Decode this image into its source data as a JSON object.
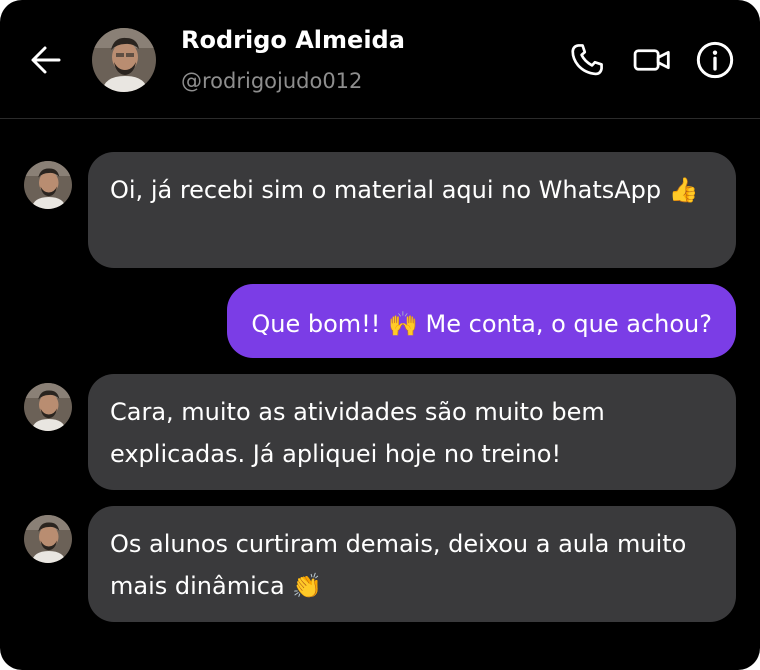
{
  "header": {
    "name": "Rodrigo Almeida",
    "handle": "@rodrigojudo012",
    "back_icon": "arrow-left-icon",
    "call_icon": "phone-icon",
    "video_icon": "video-camera-icon",
    "info_icon": "info-icon"
  },
  "messages": [
    {
      "direction": "incoming",
      "text": "Oi, já recebi sim o material aqui no WhatsApp 👍"
    },
    {
      "direction": "outgoing",
      "text": "Que bom!! 🙌 Me conta, o que achou?"
    },
    {
      "direction": "incoming",
      "text": "Cara, muito as atividades são muito bem explicadas. Já apliquei hoje no treino!"
    },
    {
      "direction": "incoming",
      "text": "Os alunos curtiram demais, deixou a aula muito mais dinâmica 👏"
    }
  ],
  "colors": {
    "background": "#000000",
    "incoming_bubble": "#3a3a3c",
    "outgoing_bubble": "#7b3de6",
    "handle_text": "#8e8e8e"
  }
}
